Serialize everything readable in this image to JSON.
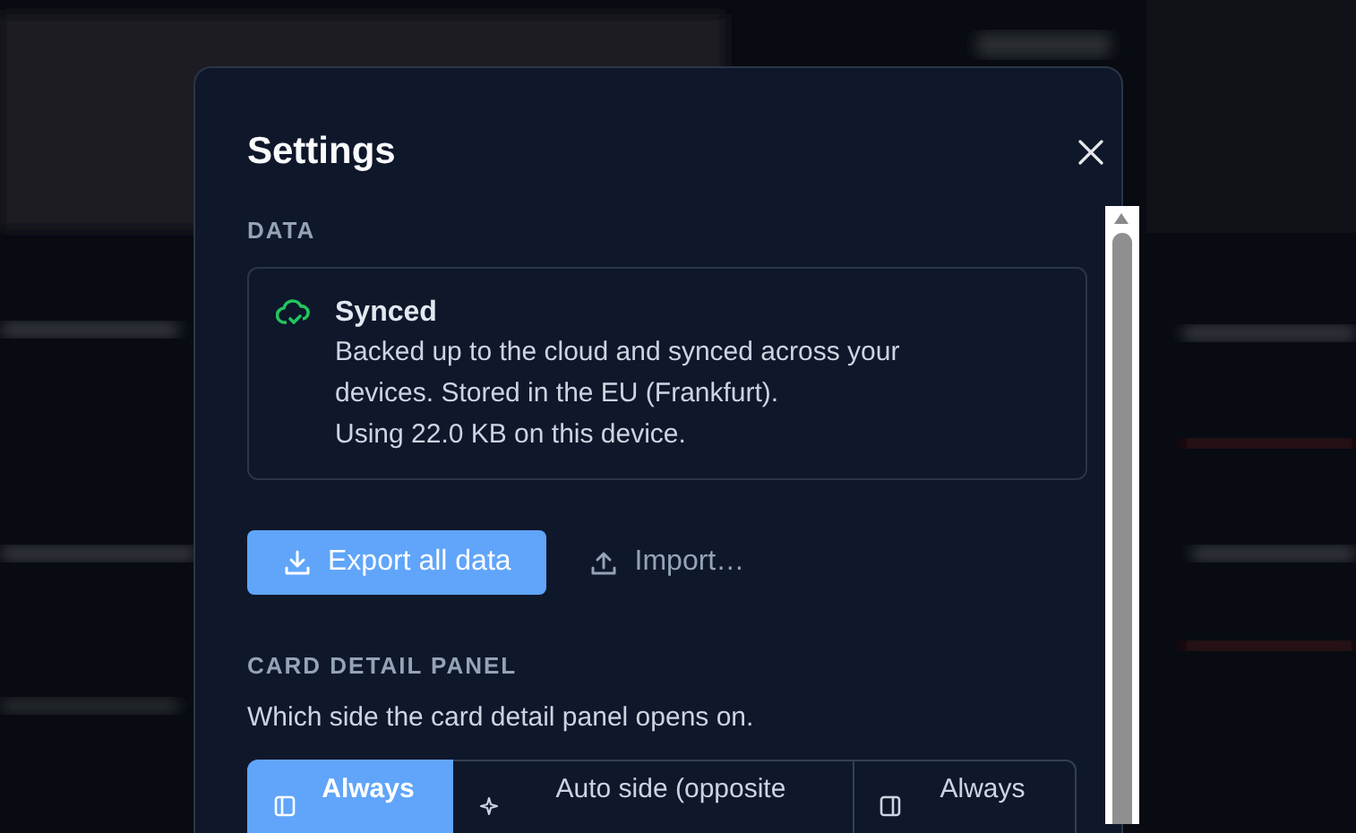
{
  "dialog": {
    "title": "Settings"
  },
  "data_section": {
    "heading": "DATA",
    "sync": {
      "status": "Synced",
      "description": "Backed up to the cloud and synced across your devices. Stored in the EU (Frankfurt).",
      "usage": "Using 22.0 KB on this device."
    },
    "buttons": [
      {
        "label": "Export all data",
        "kind": "primary"
      },
      {
        "label": "Import…",
        "kind": "ghost"
      }
    ]
  },
  "card_detail_section": {
    "heading": "CARD DETAIL PANEL",
    "description": "Which side the card detail panel opens on.",
    "options": [
      {
        "label": "Always",
        "selected": true
      },
      {
        "label": "Auto side (opposite",
        "selected": false
      },
      {
        "label": "Always",
        "selected": false
      }
    ]
  }
}
